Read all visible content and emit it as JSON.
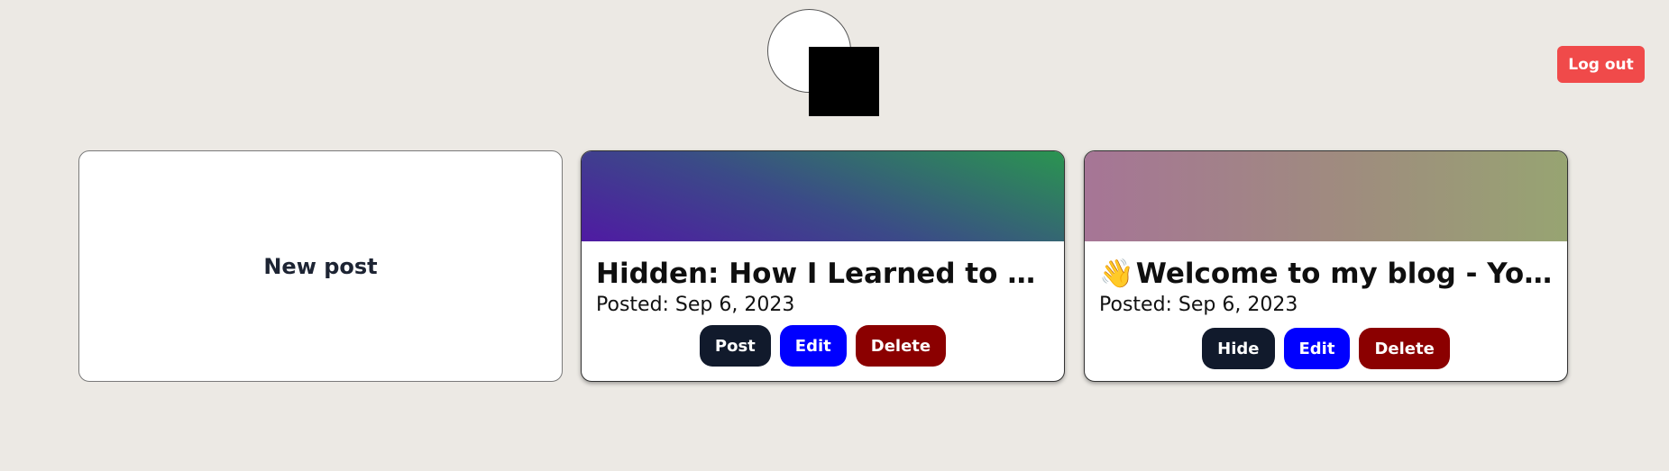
{
  "header": {
    "logout_label": "Log out"
  },
  "new_post": {
    "label": "New post"
  },
  "posts": [
    {
      "title": "Hidden: How I Learned to Stop Worrying and Love the Bomb",
      "date": "Posted: Sep 6, 2023",
      "primary_action": "Post",
      "edit_label": "Edit",
      "delete_label": "Delete",
      "cover_colors": [
        "#4f1aa3",
        "#3b4a88",
        "#2a9550"
      ]
    },
    {
      "title_emoji": "👋",
      "title": "Welcome to my blog - Your first post",
      "date": "Posted: Sep 6, 2023",
      "primary_action": "Hide",
      "edit_label": "Edit",
      "delete_label": "Delete",
      "cover_colors": [
        "#a67596",
        "#9f8c7e",
        "#97a472"
      ]
    }
  ],
  "colors": {
    "background": "#ece9e4",
    "logout": "#f04a4a",
    "primary_button": "#111a2c",
    "edit_button": "#0000ff",
    "delete_button": "#8b0000"
  }
}
